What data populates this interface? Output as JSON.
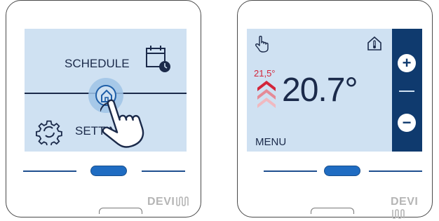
{
  "left_panel": {
    "schedule_label": "SCHEDULE",
    "settings_label": "SETTINGS",
    "icons": [
      "calendar-clock-icon",
      "home-icon",
      "gear-sync-icon",
      "hand-pointer-icon"
    ],
    "brand": "DEVI"
  },
  "right_panel": {
    "setpoint": "21,5°",
    "temperature": "20.7°",
    "menu_label": "MENU",
    "plus_label": "+",
    "minus_label": "−",
    "icons": [
      "hand-pointer-icon",
      "house-thermometer-icon",
      "heating-chevrons-icon"
    ],
    "brand": "DEVI"
  },
  "colors": {
    "screen_bg": "#cfe1f2",
    "dark_navy": "#1b2a4a",
    "accent_blue": "#1f6cc2",
    "side_bar": "#0f3a6e",
    "heating_red": "#d3253a"
  }
}
